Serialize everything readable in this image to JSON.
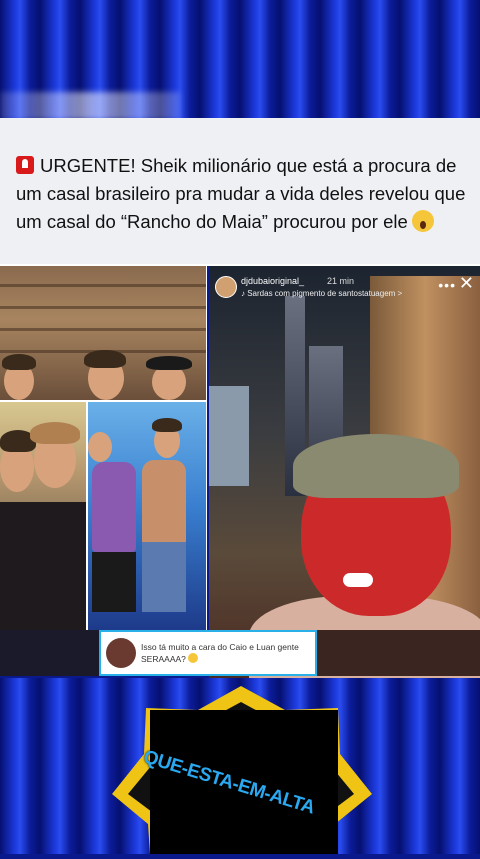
{
  "post": {
    "text": "URGENTE! Sheik milionário que está a procura de um casal brasileiro pra mudar a vida deles revelou que um casal do “Rancho do Maia” procurou por ele",
    "siren_icon": "police-siren-icon",
    "emoji_icon": "face-screaming-icon"
  },
  "story": {
    "username": "djdubaioriginal_",
    "time": "21 min",
    "music": "♪ Sardas com pigmento de santostatuagem >",
    "more_label": "•••",
    "close_label": "✕"
  },
  "comment": {
    "text": "Isso tá muito a cara do Caio e Luan gente SERAAAA?",
    "emoji_icon": "face-screaming-icon"
  },
  "watermark": {
    "text": "QUE-ESTA-EM-ALTA"
  },
  "colors": {
    "curtain": "#1a36d6",
    "comment_border": "#2ab0e8",
    "logo_yellow": "#f0c414",
    "logo_text": "#2aa8f0"
  }
}
